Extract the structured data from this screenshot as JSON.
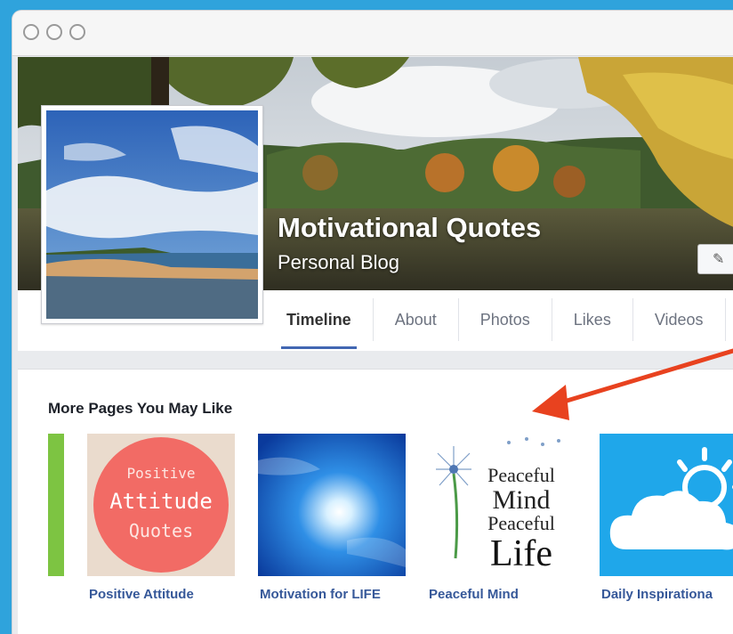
{
  "page": {
    "name": "Motivational Quotes",
    "category": "Personal Blog"
  },
  "tabs": [
    "Timeline",
    "About",
    "Photos",
    "Likes",
    "Videos"
  ],
  "edit_button_icon": "pencil-icon",
  "more_pages": {
    "title": "More Pages You May Like",
    "items": [
      {
        "label": "Positive Attitude",
        "thumb_text": [
          "Positive",
          "Attitude",
          "Quotes"
        ]
      },
      {
        "label": "Motivation for LIFE"
      },
      {
        "label": "Peaceful Mind",
        "thumb_text": [
          "Peaceful",
          "Mind",
          "Peaceful",
          "Life"
        ]
      },
      {
        "label": "Daily Inspirationa"
      }
    ]
  },
  "colors": {
    "background": "#2fa3dc",
    "tab_underline": "#4267b2",
    "link": "#365899",
    "arrow": "#e8421f",
    "attitude_circle": "#f26b65"
  }
}
